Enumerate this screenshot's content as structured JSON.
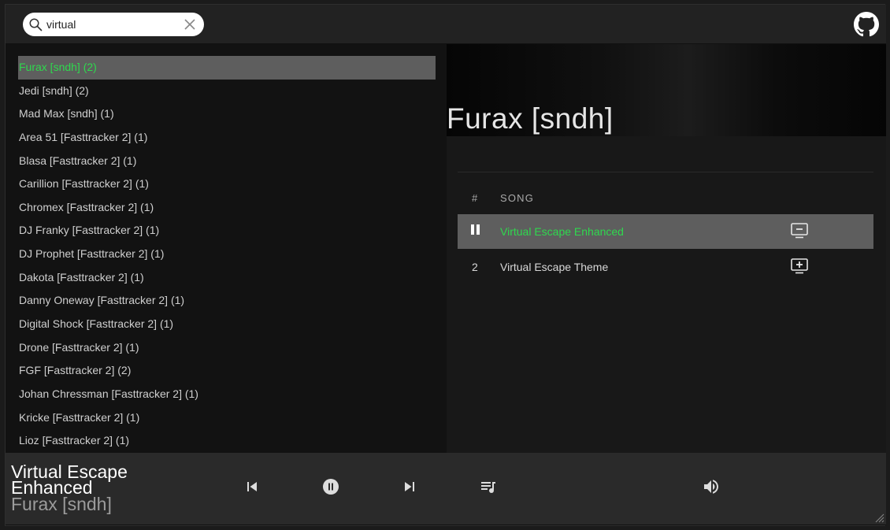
{
  "search": {
    "value": "virtual",
    "placeholder": ""
  },
  "artists": [
    {
      "label": "Furax [sndh] (2)",
      "selected": true
    },
    {
      "label": "Jedi [sndh] (2)"
    },
    {
      "label": "Mad Max [sndh] (1)"
    },
    {
      "label": "Area 51 [Fasttracker 2] (1)"
    },
    {
      "label": "Blasa [Fasttracker 2] (1)"
    },
    {
      "label": "Carillion [Fasttracker 2] (1)"
    },
    {
      "label": "Chromex [Fasttracker 2] (1)"
    },
    {
      "label": "DJ Franky [Fasttracker 2] (1)"
    },
    {
      "label": "DJ Prophet [Fasttracker 2] (1)"
    },
    {
      "label": "Dakota [Fasttracker 2] (1)"
    },
    {
      "label": "Danny Oneway [Fasttracker 2] (1)"
    },
    {
      "label": "Digital Shock [Fasttracker 2] (1)"
    },
    {
      "label": "Drone [Fasttracker 2] (1)"
    },
    {
      "label": "FGF [Fasttracker 2] (2)"
    },
    {
      "label": "Johan Chressman [Fasttracker 2] (1)"
    },
    {
      "label": "Kricke [Fasttracker 2] (1)"
    },
    {
      "label": "Lioz [Fasttracker 2] (1)"
    }
  ],
  "detail": {
    "title": "Furax [sndh]",
    "table": {
      "col_num": "#",
      "col_song": "SONG",
      "rows": [
        {
          "num": "",
          "title": "Virtual Escape Enhanced",
          "playing": true,
          "action_icon": "remove-from-playlist-icon"
        },
        {
          "num": "2",
          "title": "Virtual Escape Theme",
          "playing": false,
          "action_icon": "add-to-playlist-icon"
        }
      ]
    }
  },
  "player": {
    "title": "Virtual Escape Enhanced",
    "artist": "Furax [sndh]",
    "controls": [
      "previous-icon",
      "pause-icon",
      "next-icon",
      "playlist-icon",
      "volume-icon"
    ]
  },
  "colors": {
    "accent": "#2fd84e",
    "selected_bg": "#5e5e5e"
  }
}
